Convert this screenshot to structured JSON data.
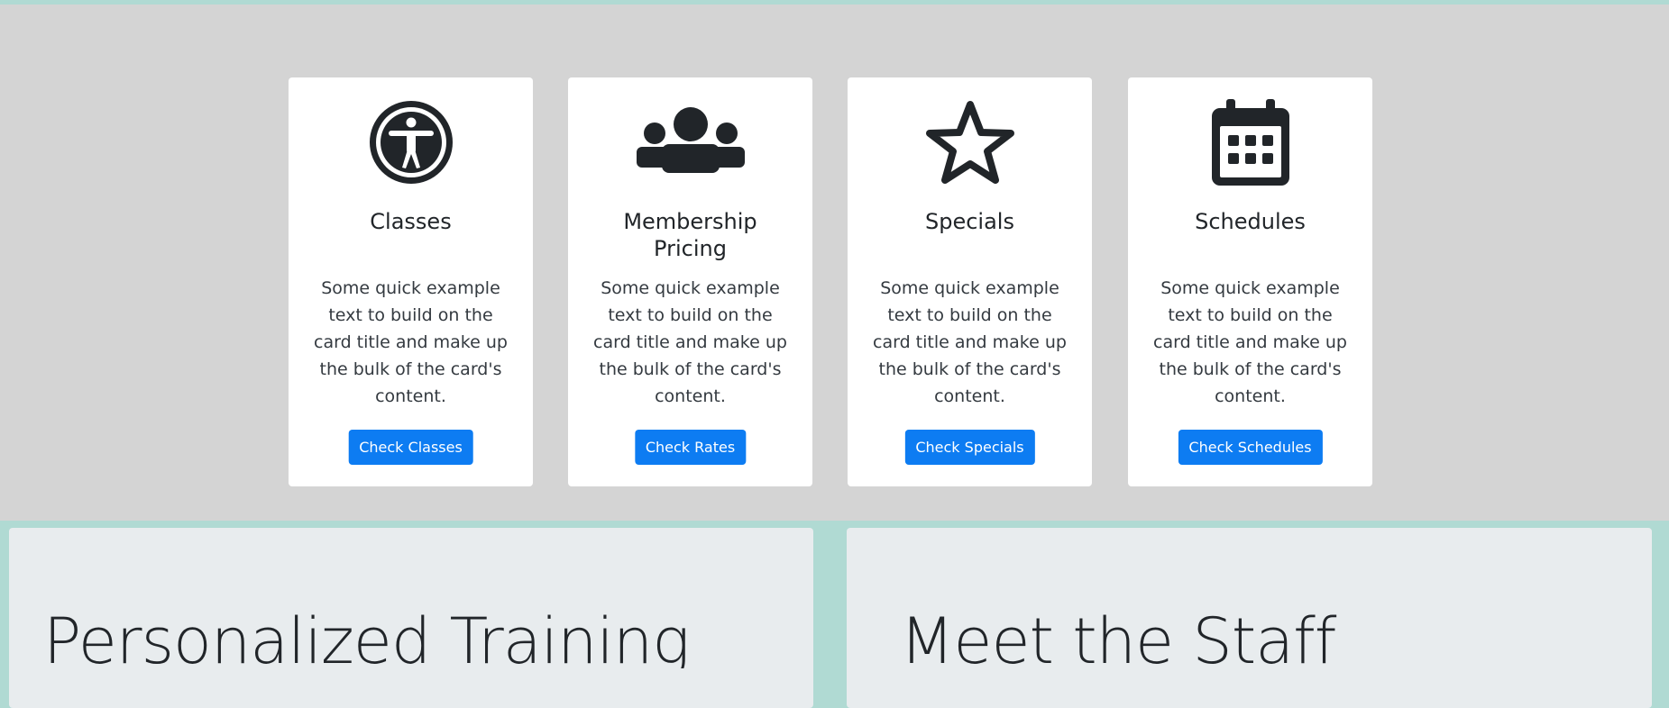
{
  "cards": [
    {
      "icon": "accessibility-icon",
      "title": "Classes",
      "text": "Some quick example text to build on the card title and make up the bulk of the card's content.",
      "button": "Check Classes"
    },
    {
      "icon": "users-icon",
      "title": "Membership Pricing",
      "text": "Some quick example text to build on the card title and make up the bulk of the card's content.",
      "button": "Check Rates"
    },
    {
      "icon": "star-icon",
      "title": "Specials",
      "text": "Some quick example text to build on the card title and make up the bulk of the card's content.",
      "button": "Check Specials"
    },
    {
      "icon": "calendar-icon",
      "title": "Schedules",
      "text": "Some quick example text to build on the card title and make up the bulk of the card's content.",
      "button": "Check Schedules"
    }
  ],
  "panels": {
    "left_heading": "Personalized Training",
    "right_heading": "Meet the Staff"
  },
  "colors": {
    "page_background": "#b0dad3",
    "cards_band": "#d4d4d4",
    "button": "#0d7cf2",
    "panel": "#e8ecee"
  }
}
